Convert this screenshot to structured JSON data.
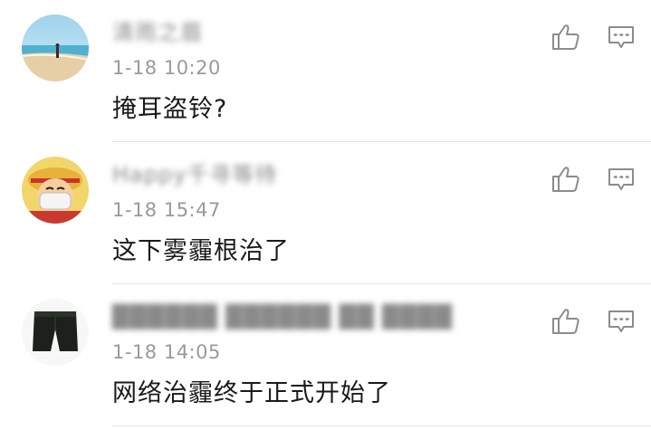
{
  "comments": [
    {
      "username": "清雨之眉",
      "time": "1-18 10:20",
      "text": "掩耳盗铃?",
      "avatar": "beach-photo-avatar"
    },
    {
      "username": "Happy千寻等待",
      "time": "1-18 15:47",
      "text": "这下雾霾根治了",
      "avatar": "cartoon-pirate-masked-avatar"
    },
    {
      "username": "██████ ██████ ██ ████",
      "time": "1-18 14:05",
      "text": "网络治霾终于正式开始了",
      "avatar": "shorts-photo-avatar"
    }
  ],
  "icons": {
    "like": "thumbs-up-icon",
    "reply": "comment-bubble-icon"
  }
}
